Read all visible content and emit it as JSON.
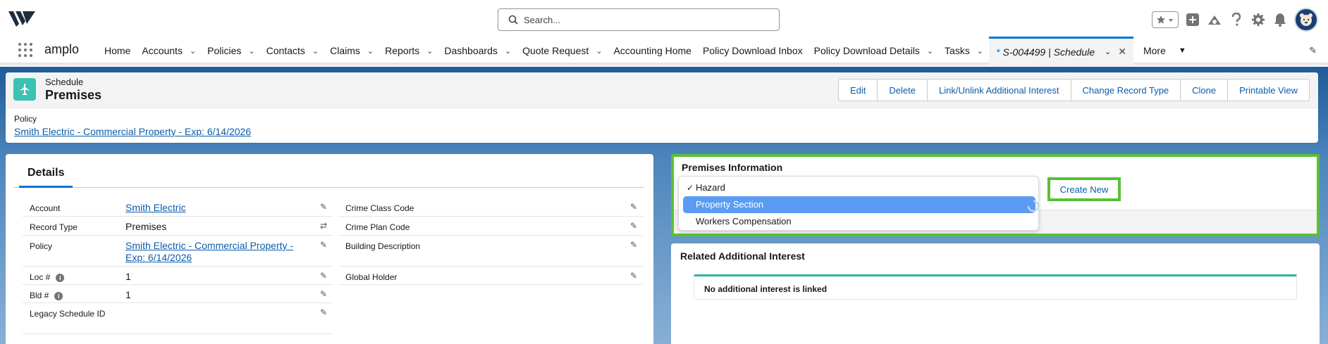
{
  "header": {
    "search_placeholder": "Search...",
    "icons": [
      "favorites-star-icon",
      "add-icon",
      "trailhead-icon",
      "help-icon",
      "setup-gear-icon",
      "notifications-bell-icon",
      "user-avatar"
    ]
  },
  "nav": {
    "app_name": "amplo",
    "items": [
      {
        "label": "Home",
        "has_menu": false
      },
      {
        "label": "Accounts",
        "has_menu": true
      },
      {
        "label": "Policies",
        "has_menu": true
      },
      {
        "label": "Contacts",
        "has_menu": true
      },
      {
        "label": "Claims",
        "has_menu": true
      },
      {
        "label": "Reports",
        "has_menu": true
      },
      {
        "label": "Dashboards",
        "has_menu": true
      },
      {
        "label": "Quote Request",
        "has_menu": true
      },
      {
        "label": "Accounting Home",
        "has_menu": false
      },
      {
        "label": "Policy Download Inbox",
        "has_menu": false
      },
      {
        "label": "Policy Download Details",
        "has_menu": true
      },
      {
        "label": "Tasks",
        "has_menu": true
      }
    ],
    "active_tab": {
      "marker": "*",
      "label": "S-004499 | Schedule"
    },
    "more_label": "More"
  },
  "record": {
    "object_type": "Schedule",
    "name": "Premises",
    "actions": [
      "Edit",
      "Delete",
      "Link/Unlink Additional Interest",
      "Change Record Type",
      "Clone",
      "Printable View"
    ],
    "highlight_label": "Policy",
    "highlight_value": "Smith Electric - Commercial Property - Exp: 6/14/2026"
  },
  "details": {
    "tab_label": "Details",
    "left_fields": [
      {
        "label": "Account",
        "value": "Smith Electric",
        "link": true
      },
      {
        "label": "Record Type",
        "value": "Premises",
        "link": false
      },
      {
        "label": "Policy",
        "value": "Smith Electric - Commercial Property - Exp: 6/14/2026",
        "link": true
      },
      {
        "label": "Loc #",
        "value": "1",
        "link": false,
        "info": true
      },
      {
        "label": "Bld #",
        "value": "1",
        "link": false,
        "info": true
      },
      {
        "label": "Legacy Schedule ID",
        "value": "",
        "link": false
      }
    ],
    "right_fields": [
      {
        "label": "Crime Class Code",
        "value": ""
      },
      {
        "label": "Crime Plan Code",
        "value": ""
      },
      {
        "label": "Building Description",
        "value": ""
      },
      {
        "label": "Global Holder",
        "value": ""
      }
    ]
  },
  "premises": {
    "title": "Premises Information",
    "create_new_label": "Create New",
    "dropdown_options": [
      {
        "label": "Hazard",
        "checked": true,
        "highlighted": false
      },
      {
        "label": "Property Section",
        "checked": false,
        "highlighted": true
      },
      {
        "label": "Workers Compensation",
        "checked": false,
        "highlighted": false
      }
    ]
  },
  "related": {
    "title": "Related Additional Interest",
    "empty_message": "No additional interest is linked"
  },
  "colors": {
    "brand_blue": "#0176d3",
    "link_blue": "#0b5cab",
    "highlight_green": "#59c134",
    "object_icon_teal": "#3cc2b3",
    "dropdown_selected": "#5a9cf4"
  }
}
